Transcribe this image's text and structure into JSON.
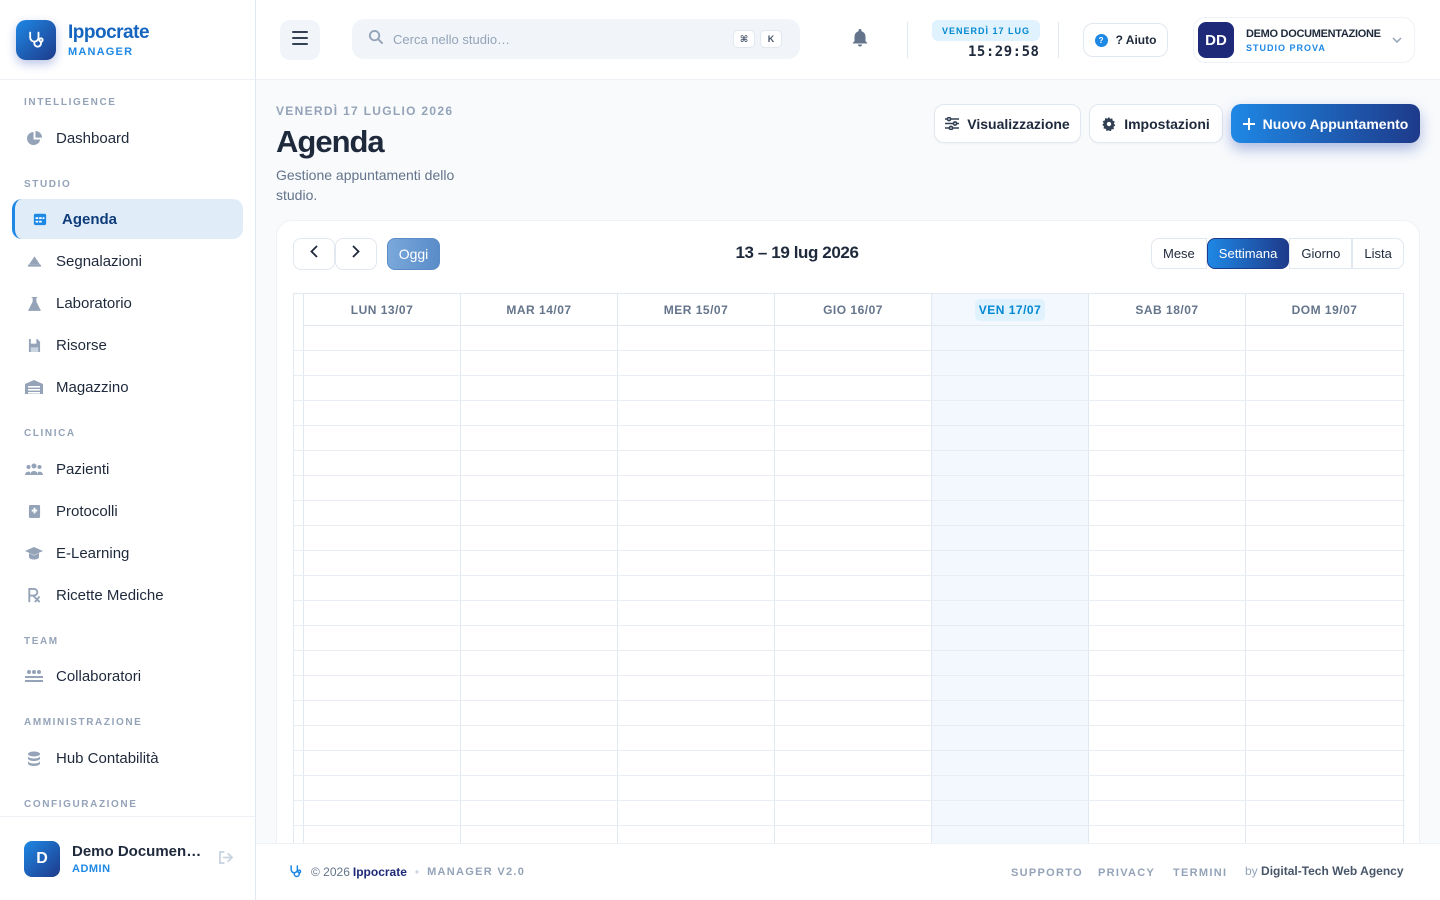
{
  "brand": {
    "name": "Ippocrate",
    "subtitle": "MANAGER"
  },
  "sidebar": {
    "sections": [
      {
        "title": "INTELLIGENCE"
      },
      {
        "title": "STUDIO"
      },
      {
        "title": "CLINICA"
      },
      {
        "title": "TEAM"
      },
      {
        "title": "AMMINISTRAZIONE"
      },
      {
        "title": "CONFIGURAZIONE"
      }
    ],
    "items": [
      {
        "label": "Dashboard",
        "icon": "pie-chart-icon"
      },
      {
        "label": "Agenda",
        "icon": "calendar-icon",
        "active": true
      },
      {
        "label": "Segnalazioni",
        "icon": "alert-icon"
      },
      {
        "label": "Laboratorio",
        "icon": "flask-icon"
      },
      {
        "label": "Risorse",
        "icon": "box-icon"
      },
      {
        "label": "Magazzino",
        "icon": "warehouse-icon"
      },
      {
        "label": "Pazienti",
        "icon": "users-icon"
      },
      {
        "label": "Protocolli",
        "icon": "file-medical-icon"
      },
      {
        "label": "E-Learning",
        "icon": "graduation-cap-icon"
      },
      {
        "label": "Ricette Mediche",
        "icon": "prescription-icon"
      },
      {
        "label": "Collaboratori",
        "icon": "team-icon"
      },
      {
        "label": "Hub Contabilità",
        "icon": "coins-icon"
      }
    ],
    "user": {
      "initial": "D",
      "name": "Demo Documentazione",
      "role": "ADMIN"
    }
  },
  "header": {
    "search_placeholder": "Cerca nello studio…",
    "kbd": [
      "⌘",
      "K"
    ],
    "date_chip": "VENERDÌ 17 LUG",
    "clock": "15:29:58",
    "help_label": "? Aiuto",
    "user": {
      "initials": "DD",
      "name": "DEMO DOCUMENTAZIONE",
      "studio": "STUDIO PROVA"
    }
  },
  "page": {
    "date": "VENERDÌ 17 LUGLIO 2026",
    "title": "Agenda",
    "subtitle": "Gestione appuntamenti dello studio.",
    "buttons": {
      "view": "Visualizzazione",
      "settings": "Impostazioni",
      "new": "Nuovo Appuntamento"
    }
  },
  "calendar": {
    "today_label": "Oggi",
    "range": "13 – 19 lug 2026",
    "views": [
      "Mese",
      "Settimana",
      "Giorno",
      "Lista"
    ],
    "active_view": "Settimana",
    "days": [
      "LUN 13/07",
      "MAR 14/07",
      "MER 15/07",
      "GIO 16/07",
      "VEN 17/07",
      "SAB 18/07",
      "DOM 19/07"
    ],
    "today_index": 4
  },
  "footer": {
    "copyright": "© 2026",
    "brand": "Ippocrate",
    "version": "MANAGER V2.0",
    "links": [
      "SUPPORTO",
      "PRIVACY",
      "TERMINI"
    ],
    "by": "by",
    "agency": "Digital-Tech Web Agency"
  },
  "colors": {
    "accent": "#1e88e5",
    "brand_dark": "#1e3a8a",
    "today_bg": "#f2f8fd"
  }
}
